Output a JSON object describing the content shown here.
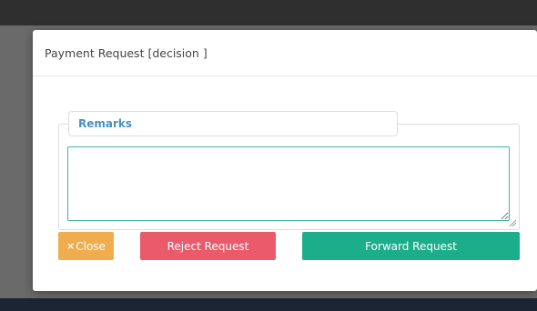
{
  "modal": {
    "title": "Payment Request [decision ]"
  },
  "remarks": {
    "label": "Remarks",
    "value": "",
    "placeholder": ""
  },
  "buttons": {
    "close_icon": "×",
    "close_label": "Close",
    "reject_label": "Reject Request",
    "forward_label": "Forward Request"
  },
  "colors": {
    "close": "#f0ad4e",
    "reject": "#ea5a6a",
    "forward": "#1cae8a",
    "remarks_label": "#4a90c2",
    "textarea_border": "#45b3a5"
  },
  "icons": {
    "close": "x-icon",
    "textarea_resize": "resize-grip-icon"
  }
}
